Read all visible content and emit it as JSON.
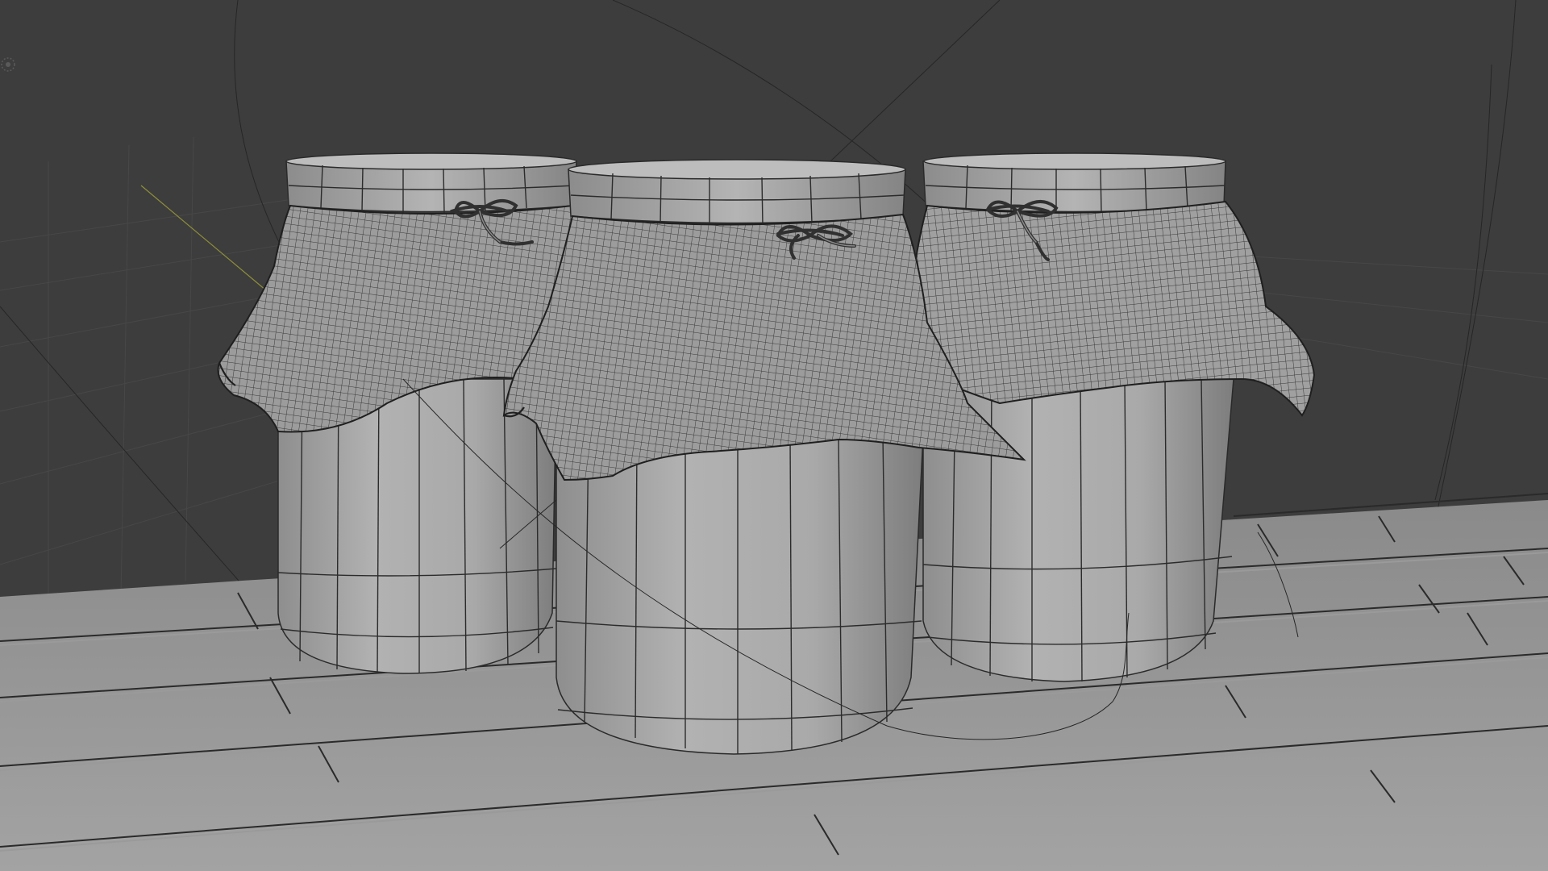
{
  "viewport": {
    "shading": "solid-wireframe",
    "colors": {
      "background": "#3d3d3d",
      "grid": "#4a4a4a",
      "mesh": "#a7a7a7",
      "wire": "#1e1e1e",
      "floor": "#9b9b9b",
      "cloth": "#9a9a9a",
      "axis_y": "#8f8f3a"
    }
  },
  "scene": {
    "objects": [
      {
        "kind": "jar",
        "covered_with": "cloth",
        "tied_with": "string-bow"
      },
      {
        "kind": "jar",
        "covered_with": "cloth",
        "tied_with": "string-bow"
      },
      {
        "kind": "jar",
        "covered_with": "cloth",
        "tied_with": "string-bow"
      }
    ],
    "floor": "tiled-planks",
    "gizmo_icon": "light-icon"
  }
}
